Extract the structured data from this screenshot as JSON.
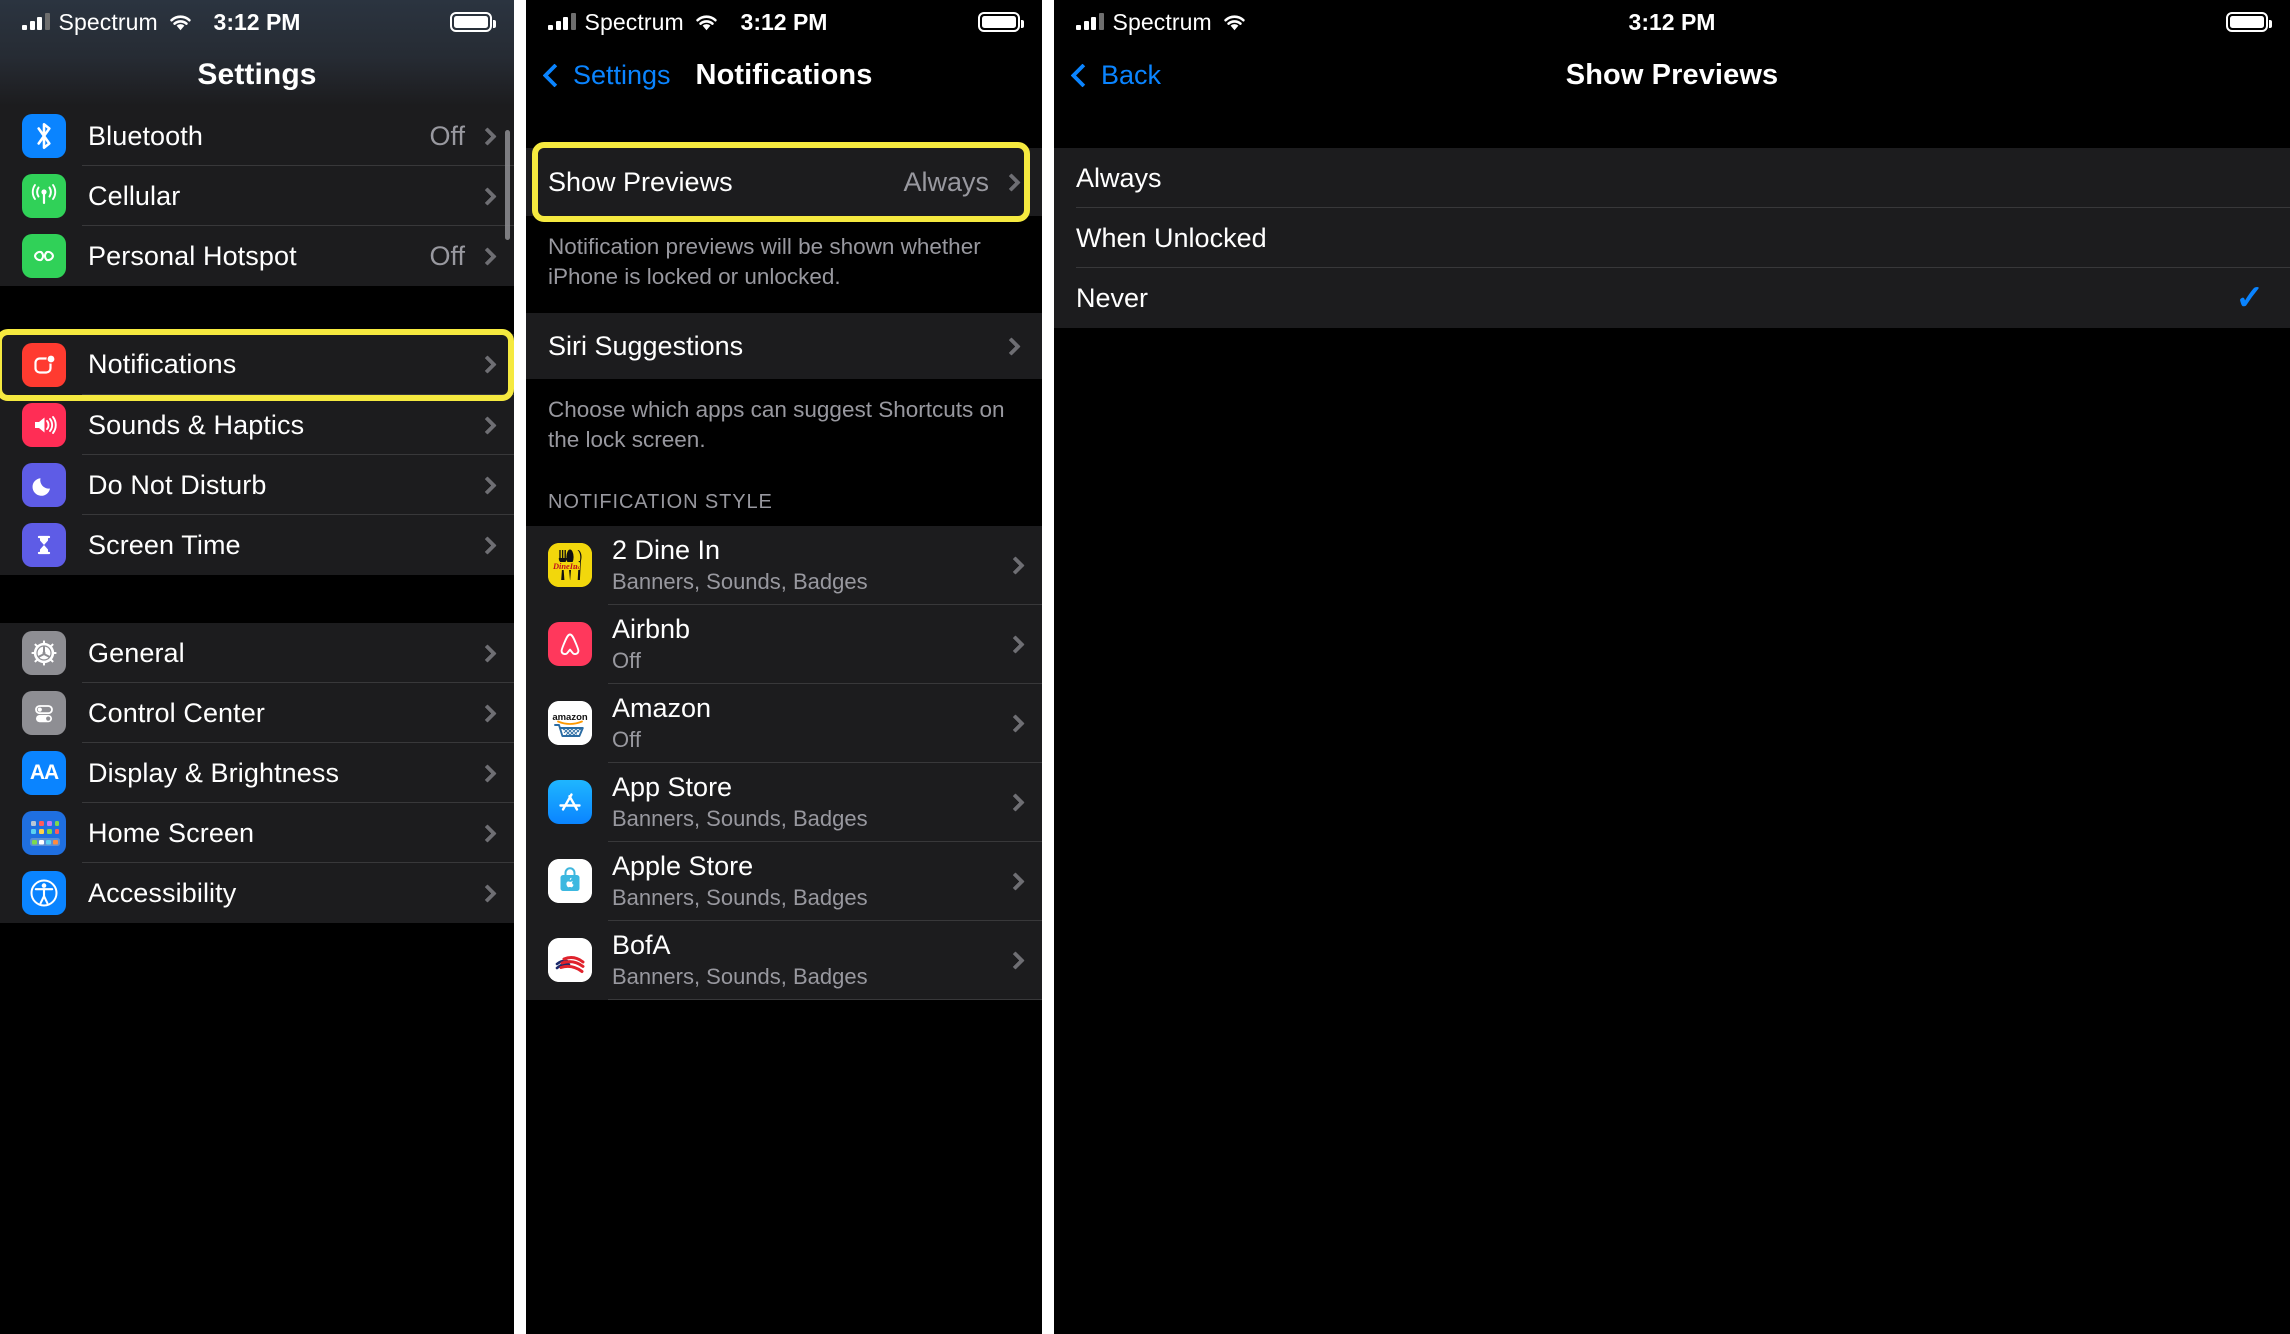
{
  "status_bar": {
    "carrier": "Spectrum",
    "time": "3:12 PM",
    "signal_icon": "cellular-bars-icon",
    "wifi_icon": "wifi-icon",
    "battery_icon": "battery-full-icon"
  },
  "colors": {
    "highlight": "#f5e93f",
    "accent": "#0a84ff",
    "row_bg": "#1c1c1e",
    "page_bg": "#000000",
    "secondary_text": "#98989f"
  },
  "panel1": {
    "title": "Settings",
    "groups": [
      {
        "items": [
          {
            "label": "Bluetooth",
            "value": "Off",
            "icon": "bluetooth-icon",
            "highlighted": false
          },
          {
            "label": "Cellular",
            "value": "",
            "icon": "cellular-antenna-icon",
            "highlighted": false
          },
          {
            "label": "Personal Hotspot",
            "value": "Off",
            "icon": "personal-hotspot-icon",
            "highlighted": false
          }
        ]
      },
      {
        "items": [
          {
            "label": "Notifications",
            "value": "",
            "icon": "notifications-icon",
            "highlighted": true
          },
          {
            "label": "Sounds & Haptics",
            "value": "",
            "icon": "sounds-haptics-icon",
            "highlighted": false
          },
          {
            "label": "Do Not Disturb",
            "value": "",
            "icon": "do-not-disturb-moon-icon",
            "highlighted": false
          },
          {
            "label": "Screen Time",
            "value": "",
            "icon": "screen-time-hourglass-icon",
            "highlighted": false
          }
        ]
      },
      {
        "items": [
          {
            "label": "General",
            "value": "",
            "icon": "gear-icon",
            "highlighted": false
          },
          {
            "label": "Control Center",
            "value": "",
            "icon": "control-center-toggles-icon",
            "highlighted": false
          },
          {
            "label": "Display & Brightness",
            "value": "",
            "icon": "display-brightness-aa-icon",
            "highlighted": false
          },
          {
            "label": "Home Screen",
            "value": "",
            "icon": "home-screen-grid-icon",
            "highlighted": false
          },
          {
            "label": "Accessibility",
            "value": "",
            "icon": "accessibility-icon",
            "highlighted": false
          }
        ]
      }
    ]
  },
  "panel2": {
    "back_label": "Settings",
    "title": "Notifications",
    "show_previews": {
      "label": "Show Previews",
      "value": "Always",
      "highlighted": true
    },
    "show_previews_footnote": "Notification previews will be shown whether iPhone is locked or unlocked.",
    "siri_suggestions": {
      "label": "Siri Suggestions"
    },
    "siri_footnote": "Choose which apps can suggest Shortcuts on the lock screen.",
    "section_header": "NOTIFICATION STYLE",
    "apps": [
      {
        "name": "2 Dine In",
        "sub": "Banners, Sounds, Badges",
        "icon": "2-dine-in-app-icon"
      },
      {
        "name": "Airbnb",
        "sub": "Off",
        "icon": "airbnb-app-icon"
      },
      {
        "name": "Amazon",
        "sub": "Off",
        "icon": "amazon-app-icon"
      },
      {
        "name": "App Store",
        "sub": "Banners, Sounds, Badges",
        "icon": "app-store-app-icon"
      },
      {
        "name": "Apple Store",
        "sub": "Banners, Sounds, Badges",
        "icon": "apple-store-app-icon"
      },
      {
        "name": "BofA",
        "sub": "Banners, Sounds, Badges",
        "icon": "bofa-app-icon"
      }
    ]
  },
  "panel3": {
    "back_label": "Back",
    "title": "Show Previews",
    "options": [
      {
        "label": "Always",
        "selected": false
      },
      {
        "label": "When Unlocked",
        "selected": false
      },
      {
        "label": "Never",
        "selected": true
      }
    ],
    "checkmark": "✓"
  }
}
